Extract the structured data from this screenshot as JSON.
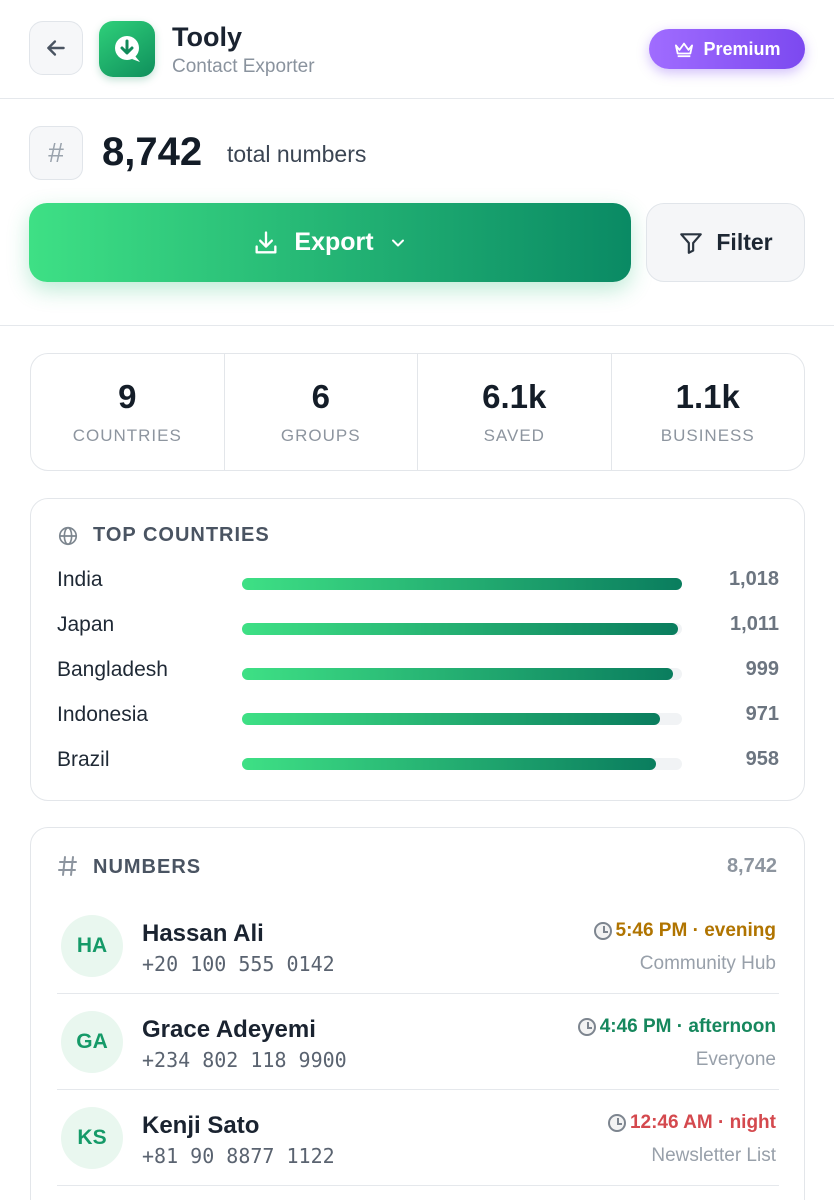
{
  "header": {
    "app_name": "Tooly",
    "app_subtitle": "Contact Exporter",
    "premium_label": "Premium"
  },
  "summary": {
    "hash_symbol": "#",
    "total": "8,742",
    "total_label": "total numbers"
  },
  "actions": {
    "export_label": "Export",
    "filter_label": "Filter"
  },
  "stats": [
    {
      "value": "9",
      "label": "COUNTRIES"
    },
    {
      "value": "6",
      "label": "GROUPS"
    },
    {
      "value": "6.1k",
      "label": "SAVED"
    },
    {
      "value": "1.1k",
      "label": "BUSINESS"
    }
  ],
  "top_countries": {
    "title": "TOP COUNTRIES",
    "rows": [
      {
        "name": "India",
        "value": "1,018",
        "fill": 1.0
      },
      {
        "name": "Japan",
        "value": "1,011",
        "fill": 0.99
      },
      {
        "name": "Bangladesh",
        "value": "999",
        "fill": 0.98
      },
      {
        "name": "Indonesia",
        "value": "971",
        "fill": 0.95
      },
      {
        "name": "Brazil",
        "value": "958",
        "fill": 0.94
      }
    ]
  },
  "numbers": {
    "title": "NUMBERS",
    "count": "8,742",
    "contacts": [
      {
        "initials": "HA",
        "name": "Hassan Ali",
        "phone": "+20 100 555 0142",
        "time": "5:46 PM · evening",
        "time_color": "#b07400",
        "group": "Community Hub"
      },
      {
        "initials": "GA",
        "name": "Grace Adeyemi",
        "phone": "+234 802 118 9900",
        "time": "4:46 PM · afternoon",
        "time_color": "#16875d",
        "group": "Everyone"
      },
      {
        "initials": "KS",
        "name": "Kenji Sato",
        "phone": "+81 90 8877 1122",
        "time": "12:46 AM · night",
        "time_color": "#d4494e",
        "group": "Newsletter List"
      }
    ]
  },
  "colors": {
    "accent_start": "#3ee085",
    "accent_end": "#0a8a64",
    "premium": "#7c49f0"
  },
  "icons": {
    "back": "arrow-left-icon",
    "logo": "download-icon",
    "premium": "crown-icon",
    "export": "download-tray-icon",
    "export_caret": "chevron-down-icon",
    "filter": "funnel-icon",
    "countries": "globe-icon",
    "numbers": "hash-icon",
    "time": "clock-icon"
  }
}
